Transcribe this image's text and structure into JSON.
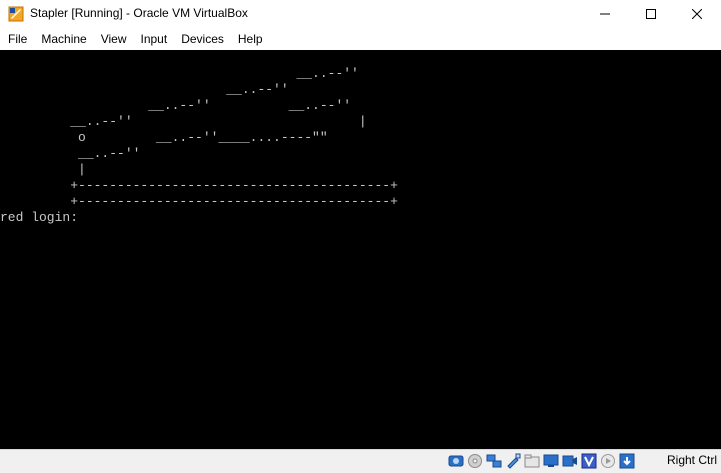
{
  "window": {
    "title": "Stapler [Running] - Oracle VM VirtualBox",
    "app_icon": "virtualbox-icon"
  },
  "menu": {
    "items": [
      "File",
      "Machine",
      "View",
      "Input",
      "Devices",
      "Help"
    ]
  },
  "console": {
    "lines": [
      "",
      "                                      __..--''",
      "                             __..--''",
      "                   __..--''          __..--''",
      "         __..--''                             |",
      "          o         __..--''____....----\"\"",
      "          __..--''",
      "          |",
      "         +----------------------------------------+",
      "         +----------------------------------------+",
      "red login: "
    ]
  },
  "statusbar": {
    "icons": [
      "hard-disk-icon",
      "optical-drive-icon",
      "network-icon",
      "usb-icon",
      "shared-folders-icon",
      "display-icon",
      "video-capture-icon",
      "virtualization-icon",
      "mouse-integration-icon",
      "keyboard-capture-icon"
    ],
    "host_key": "Right Ctrl"
  }
}
